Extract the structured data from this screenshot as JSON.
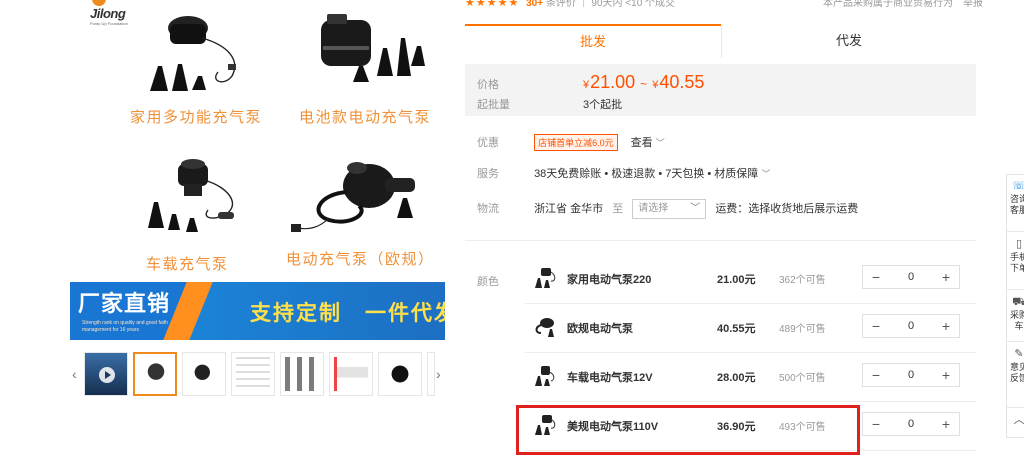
{
  "brand": {
    "logo_text": "Jilong",
    "tagline": "Pump Up Foundation"
  },
  "gallery": {
    "products": [
      {
        "caption": "家用多功能充气泵"
      },
      {
        "caption": "电池款电动充气泵"
      },
      {
        "caption": "车载充气泵"
      },
      {
        "caption": "电动充气泵（欧规）"
      }
    ],
    "banner": {
      "title": "厂家直销",
      "sub": "Strength rank on quality and good faith management for 16 years",
      "right": "支持定制　一件代发"
    },
    "thumb_prev": "‹",
    "thumb_next": "›"
  },
  "rating": {
    "stars": "★★★★★",
    "count": "30+",
    "suffix": "条评价 ｜ 90天内 <10 个成交"
  },
  "top_note": "本产品采购属于商业贸易行为　举报",
  "tabs": [
    {
      "label": "批发"
    },
    {
      "label": "代发"
    }
  ],
  "price": {
    "label": "价格",
    "currency": "¥",
    "min": "21.00",
    "sep": "~",
    "max": "40.55",
    "moq_label": "起批量",
    "moq_value": "3个起批"
  },
  "promo": {
    "label": "优惠",
    "coupon": "店铺首单立减6.0元",
    "more": "查看"
  },
  "service": {
    "label": "服务",
    "value": "38天免费赊账 • 极速退款 • 7天包换 • 材质保障"
  },
  "logistics": {
    "label": "物流",
    "origin": "浙江省 金华市",
    "to": "至",
    "select_placeholder": "请选择",
    "fee": "运费：选择收货地后展示运费"
  },
  "sku": {
    "label": "颜色",
    "items": [
      {
        "name": "家用电动气泵220",
        "price": "21.00元",
        "stock": "362个可售",
        "qty": "0"
      },
      {
        "name": "欧规电动气泵",
        "price": "40.55元",
        "stock": "489个可售",
        "qty": "0"
      },
      {
        "name": "车载电动气泵12V",
        "price": "28.00元",
        "stock": "500个可售",
        "qty": "0"
      },
      {
        "name": "美规电动气泵110V",
        "price": "36.90元",
        "stock": "493个可售",
        "qty": "0"
      }
    ],
    "minus": "−",
    "plus": "+"
  },
  "float_bar": {
    "items": [
      {
        "icon": "chat-icon",
        "label": "咨询客服"
      },
      {
        "icon": "phone-icon",
        "label": "手机下单"
      },
      {
        "icon": "cart-icon",
        "label": "采购车"
      },
      {
        "icon": "feedback-icon",
        "label": "意见反馈"
      }
    ]
  },
  "colors": {
    "accent": "#ff7300",
    "price": "#ff5000",
    "highlight": "#e0201c",
    "banner": "#1a8de0"
  }
}
